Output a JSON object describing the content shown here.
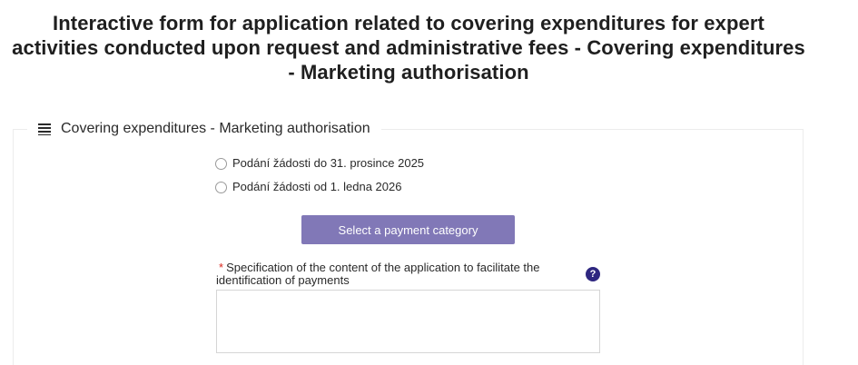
{
  "page": {
    "title": "Interactive form for application related to covering expenditures for expert activities conducted upon request and administrative fees - Covering expenditures - Marketing authorisation"
  },
  "section": {
    "legend": "Covering expenditures - Marketing authorisation",
    "legend_icon": "list-icon"
  },
  "radio_options": [
    {
      "label": "Podání žádosti do 31. prosince 2025",
      "selected": false
    },
    {
      "label": "Podání žádosti od 1. ledna 2026",
      "selected": false
    }
  ],
  "payment_button": {
    "label": "Select a payment category",
    "color": "#8178b7"
  },
  "specification": {
    "required_marker": "*",
    "label": "Specification of the content of the application to facilitate the identification of payments",
    "help_icon": "question-mark-icon",
    "help_glyph": "?",
    "value": ""
  }
}
